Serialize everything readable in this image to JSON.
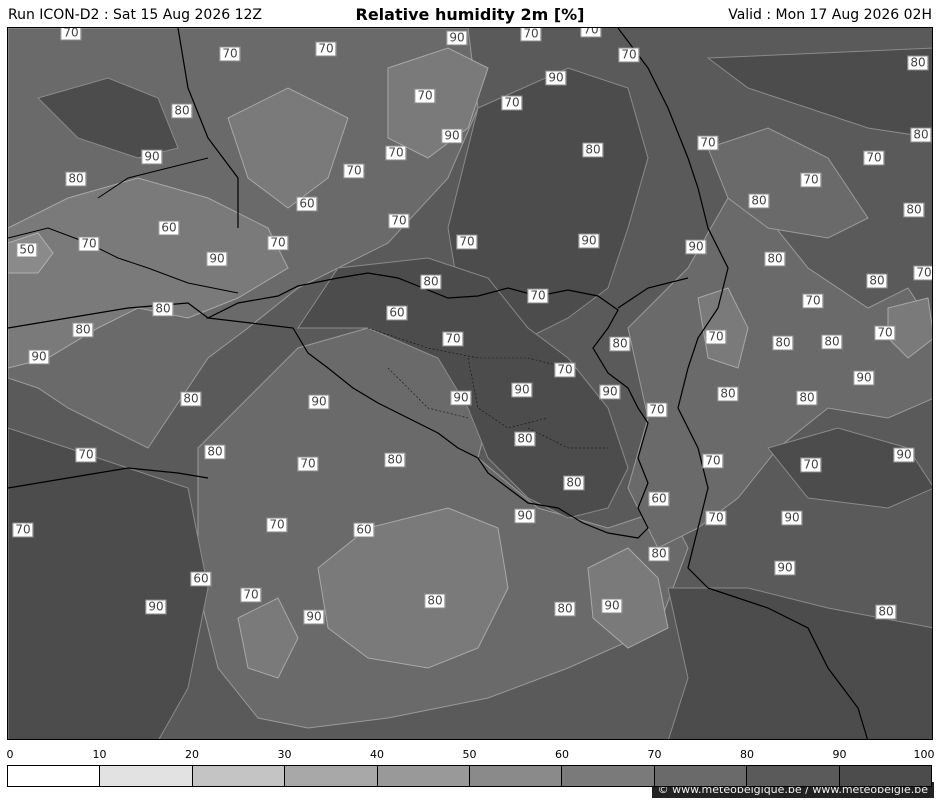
{
  "header": {
    "run": "Run ICON-D2 : Sat 15 Aug 2026 12Z",
    "title": "Relative humidity 2m [%]",
    "valid": "Valid : Mon 17 Aug 2026 02H"
  },
  "credit": "© www.meteobelgique.be / www.meteobelgie.be",
  "legend": {
    "ticks": [
      "0",
      "10",
      "20",
      "30",
      "40",
      "50",
      "60",
      "70",
      "80",
      "90",
      "100"
    ],
    "colors": [
      "#ffffff",
      "#e2e2e2",
      "#c4c4c4",
      "#a8a8a8",
      "#999999",
      "#8a8a8a",
      "#7a7a7a",
      "#6a6a6a",
      "#5a5a5a",
      "#4c4c4c"
    ]
  },
  "contour_labels": [
    "70",
    "70",
    "70",
    "90",
    "70",
    "70",
    "70",
    "80",
    "90",
    "80",
    "70",
    "70",
    "90",
    "80",
    "70",
    "90",
    "80",
    "70",
    "70",
    "70",
    "80",
    "70",
    "80",
    "80",
    "50",
    "70",
    "60",
    "60",
    "70",
    "70",
    "70",
    "90",
    "90",
    "80",
    "70",
    "90",
    "80",
    "80",
    "70",
    "70",
    "60",
    "80",
    "80",
    "70",
    "80",
    "70",
    "90",
    "80",
    "80",
    "70",
    "90",
    "70",
    "90",
    "90",
    "70",
    "80",
    "90",
    "90",
    "80",
    "80",
    "70",
    "80",
    "70",
    "80",
    "80",
    "70",
    "70",
    "90",
    "80",
    "90",
    "60",
    "70",
    "70",
    "60",
    "90",
    "70",
    "60",
    "80",
    "70",
    "90",
    "90",
    "80",
    "80",
    "90",
    "90",
    "80"
  ]
}
